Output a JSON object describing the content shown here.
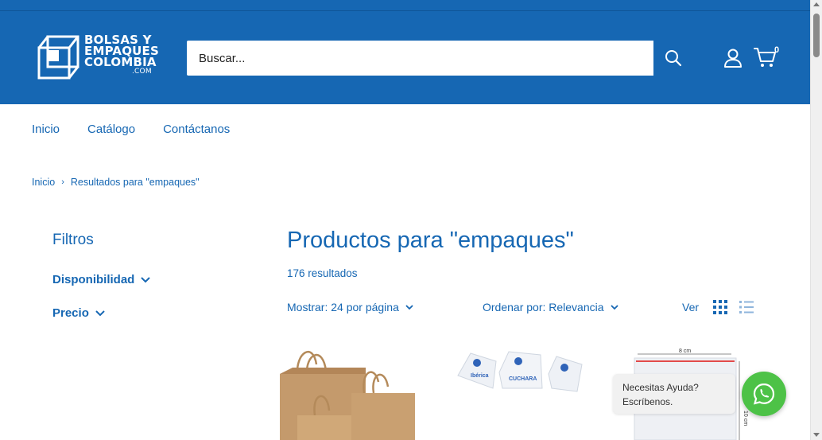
{
  "header": {
    "logo": {
      "line1": "BOLSAS Y",
      "line2": "EMPAQUES",
      "line3": "COLOMBIA",
      "line4": ".COM"
    },
    "search": {
      "placeholder": "Buscar...",
      "value": ""
    },
    "cart_count": "0",
    "icons": {
      "search": "search-icon",
      "account": "user-icon",
      "cart": "cart-icon"
    }
  },
  "nav": {
    "items": [
      {
        "label": "Inicio"
      },
      {
        "label": "Catálogo"
      },
      {
        "label": "Contáctanos"
      }
    ]
  },
  "breadcrumb": {
    "home": "Inicio",
    "current": "Resultados para \"empaques\""
  },
  "sidebar": {
    "title": "Filtros",
    "filters": [
      {
        "label": "Disponibilidad"
      },
      {
        "label": "Precio"
      }
    ]
  },
  "main": {
    "title": "Productos para \"empaques\"",
    "count": "176 resultados",
    "show_label": "Mostrar: 24 por página",
    "sort_label": "Ordenar por: Relevancia",
    "view_label": "Ver"
  },
  "products": [
    {
      "image": "kraft-paper-bags"
    },
    {
      "image": "plastic-spoon-packs",
      "brand": "Ibérica",
      "label": "CUCHARA"
    },
    {
      "image": "zip-bag",
      "width_label": "8 cm",
      "height_label": "10 cm"
    }
  ],
  "chat": {
    "line1": "Necesitas Ayuda?",
    "line2": "Escríbenos."
  },
  "colors": {
    "primary": "#1667b3",
    "whatsapp": "#4dc247",
    "kraft": "#c49a6c"
  }
}
